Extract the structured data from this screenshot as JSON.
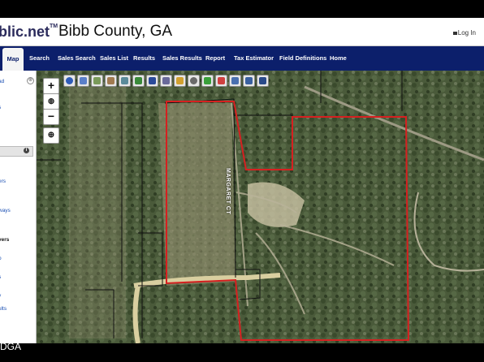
{
  "header": {
    "brand": "blic.net",
    "brand_mark": "TM",
    "county": "Bibb County, GA",
    "login": "Log In"
  },
  "nav": {
    "tabs": [
      "Map",
      "Search",
      "Sales Search",
      "Sales List",
      "Results",
      "Sales Results",
      "Report",
      "Tax Estimator",
      "Field Definitions",
      "Home"
    ],
    "active": "Map"
  },
  "sidebar": {
    "items": [
      "ad",
      "s",
      "ers",
      "ways",
      "vers",
      "p",
      "s",
      "v",
      "ults"
    ],
    "close_glyph": "⊗",
    "info_glyph": "i"
  },
  "map": {
    "zoom_in": "+",
    "zoom_out": "−",
    "globe_icon": "globe-icon",
    "locate_icon": "crosshair-icon",
    "street_label": "MARGARET CT",
    "tools": [
      "info",
      "identify",
      "zoom-box",
      "pan",
      "measure",
      "draw",
      "layers",
      "print",
      "sketch",
      "search",
      "pencil",
      "select",
      "buffer",
      "refresh",
      "save"
    ],
    "parcel_outline_color": "#d62020"
  },
  "watermark": "DGA"
}
